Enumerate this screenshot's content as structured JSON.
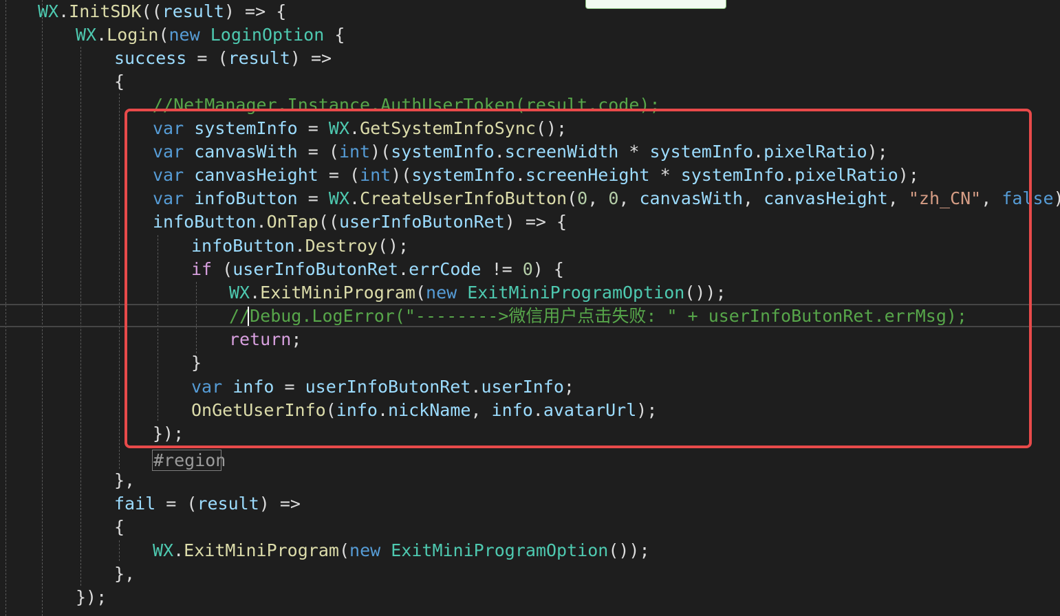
{
  "editor": {
    "theme_colors": {
      "background": "#1e1e1e",
      "highlight_border": "#e84a4a",
      "keyword": "#569cd6",
      "type": "#4ec9b0",
      "method": "#dcdcaa",
      "variable": "#9cdcfe",
      "comment": "#57a64a",
      "string": "#d69d85",
      "number": "#b5cea8",
      "flow_keyword": "#d8a0df"
    },
    "lines": [
      {
        "tokens": [
          {
            "t": "WX",
            "c": "ty"
          },
          {
            "t": ".",
            "c": "pl"
          },
          {
            "t": "InitSDK",
            "c": "fn"
          },
          {
            "t": "((",
            "c": "pl"
          },
          {
            "t": "result",
            "c": "vr"
          },
          {
            "t": ") => {",
            "c": "pl"
          }
        ]
      },
      {
        "tokens": [
          {
            "t": "WX",
            "c": "ty"
          },
          {
            "t": ".",
            "c": "pl"
          },
          {
            "t": "Login",
            "c": "fn"
          },
          {
            "t": "(",
            "c": "pl"
          },
          {
            "t": "new",
            "c": "kw"
          },
          {
            "t": " ",
            "c": "pl"
          },
          {
            "t": "LoginOption",
            "c": "ty"
          },
          {
            "t": " {",
            "c": "pl"
          }
        ]
      },
      {
        "tokens": [
          {
            "t": "success",
            "c": "vr"
          },
          {
            "t": " = (",
            "c": "pl"
          },
          {
            "t": "result",
            "c": "vr"
          },
          {
            "t": ") =>",
            "c": "pl"
          }
        ]
      },
      {
        "tokens": [
          {
            "t": "{",
            "c": "pl"
          }
        ]
      },
      {
        "tokens": [
          {
            "t": "//NetManager.Instance.AuthUserToken(result.code);",
            "c": "cm"
          }
        ]
      },
      {
        "tokens": [
          {
            "t": "var",
            "c": "kw"
          },
          {
            "t": " ",
            "c": "pl"
          },
          {
            "t": "systemInfo",
            "c": "vr"
          },
          {
            "t": " = ",
            "c": "pl"
          },
          {
            "t": "WX",
            "c": "ty"
          },
          {
            "t": ".",
            "c": "pl"
          },
          {
            "t": "GetSystemInfoSync",
            "c": "fn"
          },
          {
            "t": "();",
            "c": "pl"
          }
        ]
      },
      {
        "tokens": [
          {
            "t": "var",
            "c": "kw"
          },
          {
            "t": " ",
            "c": "pl"
          },
          {
            "t": "canvasWith",
            "c": "vr"
          },
          {
            "t": " = (",
            "c": "pl"
          },
          {
            "t": "int",
            "c": "kw"
          },
          {
            "t": ")(",
            "c": "pl"
          },
          {
            "t": "systemInfo",
            "c": "vr"
          },
          {
            "t": ".",
            "c": "pl"
          },
          {
            "t": "screenWidth",
            "c": "vr"
          },
          {
            "t": " * ",
            "c": "pl"
          },
          {
            "t": "systemInfo",
            "c": "vr"
          },
          {
            "t": ".",
            "c": "pl"
          },
          {
            "t": "pixelRatio",
            "c": "vr"
          },
          {
            "t": ");",
            "c": "pl"
          }
        ]
      },
      {
        "tokens": [
          {
            "t": "var",
            "c": "kw"
          },
          {
            "t": " ",
            "c": "pl"
          },
          {
            "t": "canvasHeight",
            "c": "vr"
          },
          {
            "t": " = (",
            "c": "pl"
          },
          {
            "t": "int",
            "c": "kw"
          },
          {
            "t": ")(",
            "c": "pl"
          },
          {
            "t": "systemInfo",
            "c": "vr"
          },
          {
            "t": ".",
            "c": "pl"
          },
          {
            "t": "screenHeight",
            "c": "vr"
          },
          {
            "t": " * ",
            "c": "pl"
          },
          {
            "t": "systemInfo",
            "c": "vr"
          },
          {
            "t": ".",
            "c": "pl"
          },
          {
            "t": "pixelRatio",
            "c": "vr"
          },
          {
            "t": ");",
            "c": "pl"
          }
        ]
      },
      {
        "tokens": [
          {
            "t": "var",
            "c": "kw"
          },
          {
            "t": " ",
            "c": "pl"
          },
          {
            "t": "infoButton",
            "c": "vr"
          },
          {
            "t": " = ",
            "c": "pl"
          },
          {
            "t": "WX",
            "c": "ty"
          },
          {
            "t": ".",
            "c": "pl"
          },
          {
            "t": "CreateUserInfoButton",
            "c": "fn"
          },
          {
            "t": "(",
            "c": "pl"
          },
          {
            "t": "0",
            "c": "nm"
          },
          {
            "t": ", ",
            "c": "pl"
          },
          {
            "t": "0",
            "c": "nm"
          },
          {
            "t": ", ",
            "c": "pl"
          },
          {
            "t": "canvasWith",
            "c": "vr"
          },
          {
            "t": ", ",
            "c": "pl"
          },
          {
            "t": "canvasHeight",
            "c": "vr"
          },
          {
            "t": ", ",
            "c": "pl"
          },
          {
            "t": "\"zh_CN\"",
            "c": "st"
          },
          {
            "t": ", ",
            "c": "pl"
          },
          {
            "t": "false",
            "c": "kw"
          },
          {
            "t": ");",
            "c": "pl"
          }
        ]
      },
      {
        "tokens": [
          {
            "t": "infoButton",
            "c": "vr"
          },
          {
            "t": ".",
            "c": "pl"
          },
          {
            "t": "OnTap",
            "c": "fn"
          },
          {
            "t": "((",
            "c": "pl"
          },
          {
            "t": "userInfoButonRet",
            "c": "vr"
          },
          {
            "t": ") => {",
            "c": "pl"
          }
        ]
      },
      {
        "tokens": [
          {
            "t": "infoButton",
            "c": "vr"
          },
          {
            "t": ".",
            "c": "pl"
          },
          {
            "t": "Destroy",
            "c": "fn"
          },
          {
            "t": "();",
            "c": "pl"
          }
        ]
      },
      {
        "tokens": [
          {
            "t": "if",
            "c": "fl"
          },
          {
            "t": " (",
            "c": "pl"
          },
          {
            "t": "userInfoButonRet",
            "c": "vr"
          },
          {
            "t": ".",
            "c": "pl"
          },
          {
            "t": "errCode",
            "c": "vr"
          },
          {
            "t": " != ",
            "c": "pl"
          },
          {
            "t": "0",
            "c": "nm"
          },
          {
            "t": ") {",
            "c": "pl"
          }
        ]
      },
      {
        "tokens": [
          {
            "t": "WX",
            "c": "ty"
          },
          {
            "t": ".",
            "c": "pl"
          },
          {
            "t": "ExitMiniProgram",
            "c": "fn"
          },
          {
            "t": "(",
            "c": "pl"
          },
          {
            "t": "new",
            "c": "kw"
          },
          {
            "t": " ",
            "c": "pl"
          },
          {
            "t": "ExitMiniProgramOption",
            "c": "ty"
          },
          {
            "t": "());",
            "c": "pl"
          }
        ]
      },
      {
        "tokens": [
          {
            "t": "//Debug.LogError(\"-------->微信用户点击失败: \" + userInfoButonRet.errMsg);",
            "c": "cm"
          }
        ]
      },
      {
        "tokens": [
          {
            "t": "return",
            "c": "fl"
          },
          {
            "t": ";",
            "c": "pl"
          }
        ]
      },
      {
        "tokens": [
          {
            "t": "}",
            "c": "pl"
          }
        ]
      },
      {
        "tokens": [
          {
            "t": "var",
            "c": "kw"
          },
          {
            "t": " ",
            "c": "pl"
          },
          {
            "t": "info",
            "c": "vr"
          },
          {
            "t": " = ",
            "c": "pl"
          },
          {
            "t": "userInfoButonRet",
            "c": "vr"
          },
          {
            "t": ".",
            "c": "pl"
          },
          {
            "t": "userInfo",
            "c": "vr"
          },
          {
            "t": ";",
            "c": "pl"
          }
        ]
      },
      {
        "tokens": [
          {
            "t": "OnGetUserInfo",
            "c": "fn"
          },
          {
            "t": "(",
            "c": "pl"
          },
          {
            "t": "info",
            "c": "vr"
          },
          {
            "t": ".",
            "c": "pl"
          },
          {
            "t": "nickName",
            "c": "vr"
          },
          {
            "t": ", ",
            "c": "pl"
          },
          {
            "t": "info",
            "c": "vr"
          },
          {
            "t": ".",
            "c": "pl"
          },
          {
            "t": "avatarUrl",
            "c": "vr"
          },
          {
            "t": ");",
            "c": "pl"
          }
        ]
      },
      {
        "tokens": [
          {
            "t": "});",
            "c": "pl"
          }
        ]
      },
      {
        "tokens": [
          {
            "t": "#region",
            "c": "rg"
          }
        ]
      },
      {
        "tokens": [
          {
            "t": "},",
            "c": "pl"
          }
        ]
      },
      {
        "tokens": [
          {
            "t": "fail",
            "c": "vr"
          },
          {
            "t": " = (",
            "c": "pl"
          },
          {
            "t": "result",
            "c": "vr"
          },
          {
            "t": ") =>",
            "c": "pl"
          }
        ]
      },
      {
        "tokens": [
          {
            "t": "{",
            "c": "pl"
          }
        ]
      },
      {
        "tokens": [
          {
            "t": "WX",
            "c": "ty"
          },
          {
            "t": ".",
            "c": "pl"
          },
          {
            "t": "ExitMiniProgram",
            "c": "fn"
          },
          {
            "t": "(",
            "c": "pl"
          },
          {
            "t": "new",
            "c": "kw"
          },
          {
            "t": " ",
            "c": "pl"
          },
          {
            "t": "ExitMiniProgramOption",
            "c": "ty"
          },
          {
            "t": "());",
            "c": "pl"
          }
        ]
      },
      {
        "tokens": [
          {
            "t": "},",
            "c": "pl"
          }
        ]
      },
      {
        "tokens": [
          {
            "t": "});",
            "c": "pl"
          }
        ]
      }
    ]
  }
}
